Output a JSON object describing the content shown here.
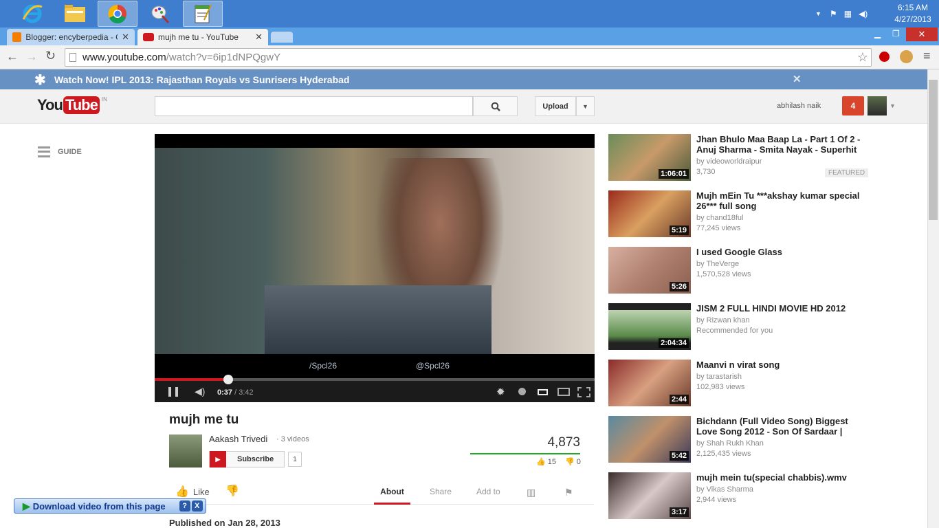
{
  "taskbar": {
    "clock_time": "6:15 AM",
    "clock_date": "4/27/2013"
  },
  "tabs": [
    {
      "label": "Blogger: encyberpedia - C"
    },
    {
      "label": "mujh me tu - YouTube"
    }
  ],
  "url": {
    "host": "www.youtube.com",
    "path": "/watch?v=6ip1dNPQgwY"
  },
  "banner": {
    "text": "Watch Now! IPL 2013: Rajasthan Royals vs Sunrisers Hyderabad"
  },
  "yt": {
    "logo": "You",
    "logo_box": "Tube",
    "region": "IN",
    "upload": "Upload",
    "user": "abhilash naik",
    "notifications": "4",
    "guide": "GUIDE"
  },
  "player": {
    "current": "0:37",
    "separator": "/",
    "total": "3:42",
    "progress_fraction": 0.167,
    "overlay1": "/Spcl26",
    "overlay2": "@Spcl26"
  },
  "video": {
    "title": "mujh me tu",
    "uploader": "Aakash Trivedi",
    "video_count": "· 3 videos",
    "subscribe": "Subscribe",
    "subscriber_count": "1",
    "views": "4,873",
    "likes": "15",
    "dislikes": "0",
    "like_label": "Like",
    "published": "Published on Jan 28, 2013"
  },
  "action_tabs": {
    "about": "About",
    "share": "Share",
    "add_to": "Add to"
  },
  "related": [
    {
      "title": "Jhan Bhulo Maa Baap La - Part 1 Of 2 - Anuj Sharma - Smita Nayak - Superhit",
      "by": "by videoworldraipur",
      "meta": "3,730",
      "duration": "1:06:01",
      "badge": "FEATURED"
    },
    {
      "title": "Mujh mEin Tu ***akshay kumar special 26*** full song",
      "by": "by chand18ful",
      "meta": "77,245 views",
      "duration": "5:19"
    },
    {
      "title": "I used Google Glass",
      "by": "by TheVerge",
      "meta": "1,570,528 views",
      "duration": "5:26"
    },
    {
      "title": "JISM 2 FULL HINDI MOVIE HD 2012",
      "by": "by Rizwan khan",
      "meta": "Recommended for you",
      "duration": "2:04:34"
    },
    {
      "title": "Maanvi n virat song",
      "by": "by tarastarish",
      "meta": "102,983 views",
      "duration": "2:44"
    },
    {
      "title": "Bichdann (Full Video Song) Biggest Love Song 2012 - Son Of Sardaar |",
      "by": "by Shah Rukh Khan",
      "meta": "2,125,435 views",
      "duration": "5:42"
    },
    {
      "title": "mujh mein tu(special chabbis).wmv",
      "by": "by Vikas Sharma",
      "meta": "2,944 views",
      "duration": "3:17"
    }
  ],
  "download_bar": {
    "label": "Download video from this page",
    "help": "?",
    "close": "X"
  }
}
